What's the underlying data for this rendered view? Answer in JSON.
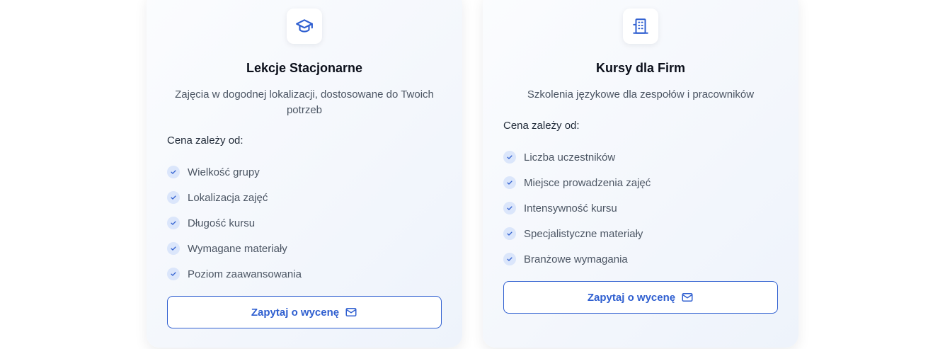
{
  "cards": [
    {
      "icon": "graduation-cap-icon",
      "title": "Lekcje Stacjonarne",
      "description": "Zajęcia w dogodnej lokalizacji, dostosowane do Twoich potrzeb",
      "price_label": "Cena zależy od:",
      "features": [
        "Wielkość grupy",
        "Lokalizacja zajęć",
        "Długość kursu",
        "Wymagane materiały",
        "Poziom zaawansowania"
      ],
      "cta_label": "Zapytaj o wycenę"
    },
    {
      "icon": "office-building-icon",
      "title": "Kursy dla Firm",
      "description": "Szkolenia językowe dla zespołów i pracowników",
      "price_label": "Cena zależy od:",
      "features": [
        "Liczba uczestników",
        "Miejsce prowadzenia zajęć",
        "Intensywność kursu",
        "Specjalistyczne materiały",
        "Branżowe wymagania"
      ],
      "cta_label": "Zapytaj o wycenę"
    }
  ],
  "colors": {
    "accent": "#2f5fd0",
    "check_bg": "#dbe6fb",
    "title": "#0b0f1a",
    "text_muted": "#4b5563"
  }
}
